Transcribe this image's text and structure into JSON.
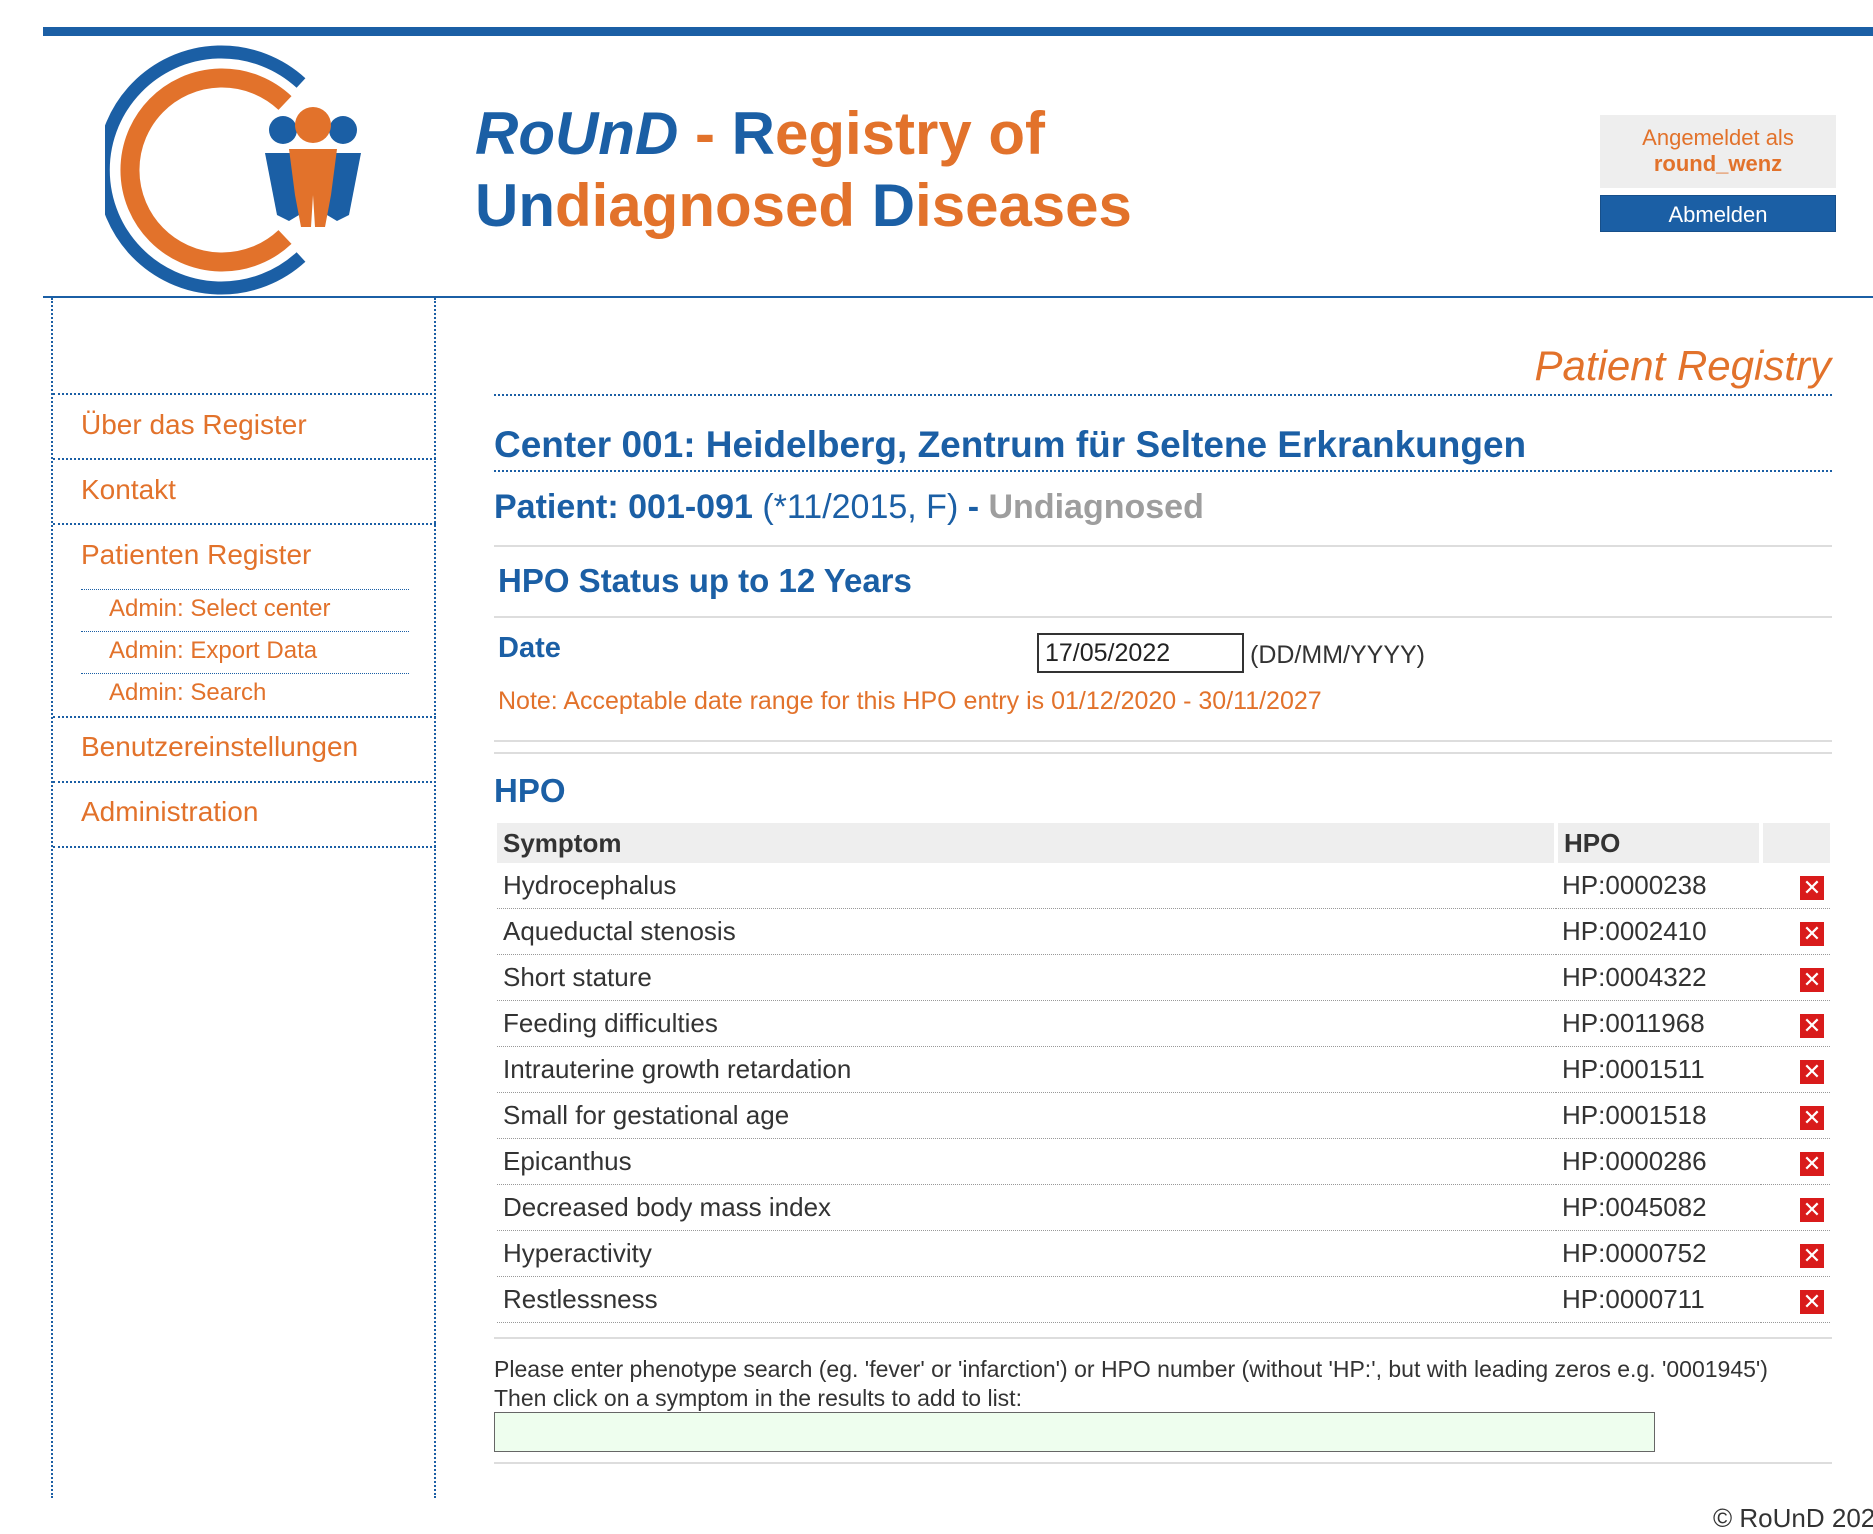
{
  "header": {
    "title_round": "RoUnD",
    "title_dash": " - ",
    "title_r": "R",
    "title_egistry": "egistry of",
    "title_un": "Un",
    "title_diagnosed": "diagnosed ",
    "title_d": "D",
    "title_iseases": "iseases",
    "logged_in_label": "Angemeldet als",
    "username": "round_wenz",
    "logout_label": "Abmelden"
  },
  "sidebar": {
    "items": [
      {
        "label": "Über das Register"
      },
      {
        "label": "Kontakt"
      },
      {
        "label": "Patienten Register"
      },
      {
        "label": "Benutzereinstellungen"
      },
      {
        "label": "Administration"
      }
    ],
    "subitems": [
      {
        "label": "Admin: Select center"
      },
      {
        "label": "Admin: Export Data"
      },
      {
        "label": "Admin: Search"
      }
    ]
  },
  "main": {
    "registry_title": "Patient Registry",
    "center_title": "Center 001: Heidelberg, Zentrum für Seltene Erkrankungen",
    "patient_label": "Patient: 001-091",
    "patient_meta": " (*11/2015, F) ",
    "patient_sep": " - ",
    "patient_status": "Undiagnosed",
    "section_title": "HPO Status up to 12 Years",
    "date_label": "Date",
    "date_value": "17/05/2022",
    "date_format": "(DD/MM/YYYY)",
    "date_note": "Note: Acceptable date range for this HPO entry is 01/12/2020 - 30/11/2027",
    "hpo_title": "HPO",
    "table": {
      "col_symptom": "Symptom",
      "col_hpo": "HPO",
      "rows": [
        {
          "symptom": "Hydrocephalus",
          "hpo": "HP:0000238"
        },
        {
          "symptom": "Aqueductal stenosis",
          "hpo": "HP:0002410"
        },
        {
          "symptom": "Short stature",
          "hpo": "HP:0004322"
        },
        {
          "symptom": "Feeding difficulties",
          "hpo": "HP:0011968"
        },
        {
          "symptom": "Intrauterine growth retardation",
          "hpo": "HP:0001511"
        },
        {
          "symptom": "Small for gestational age",
          "hpo": "HP:0001518"
        },
        {
          "symptom": "Epicanthus",
          "hpo": "HP:0000286"
        },
        {
          "symptom": "Decreased body mass index",
          "hpo": "HP:0045082"
        },
        {
          "symptom": "Hyperactivity",
          "hpo": "HP:0000752"
        },
        {
          "symptom": "Restlessness",
          "hpo": "HP:0000711"
        }
      ],
      "delete_icon": "close-icon",
      "delete_glyph": "✕"
    },
    "help_line1": "Please enter phenotype search (eg. 'fever' or 'infarction') or HPO number (without 'HP:', but with leading zeros e.g. '0001945')",
    "help_line2": "Then click on a symptom in the results to add to list:",
    "search_value": ""
  },
  "footer": {
    "copyright": "© RoUnD 202"
  },
  "colors": {
    "brand_blue": "#1b5fa5",
    "brand_orange": "#e2722b",
    "delete_red": "#d91b1b",
    "search_bg": "#eefeee"
  }
}
